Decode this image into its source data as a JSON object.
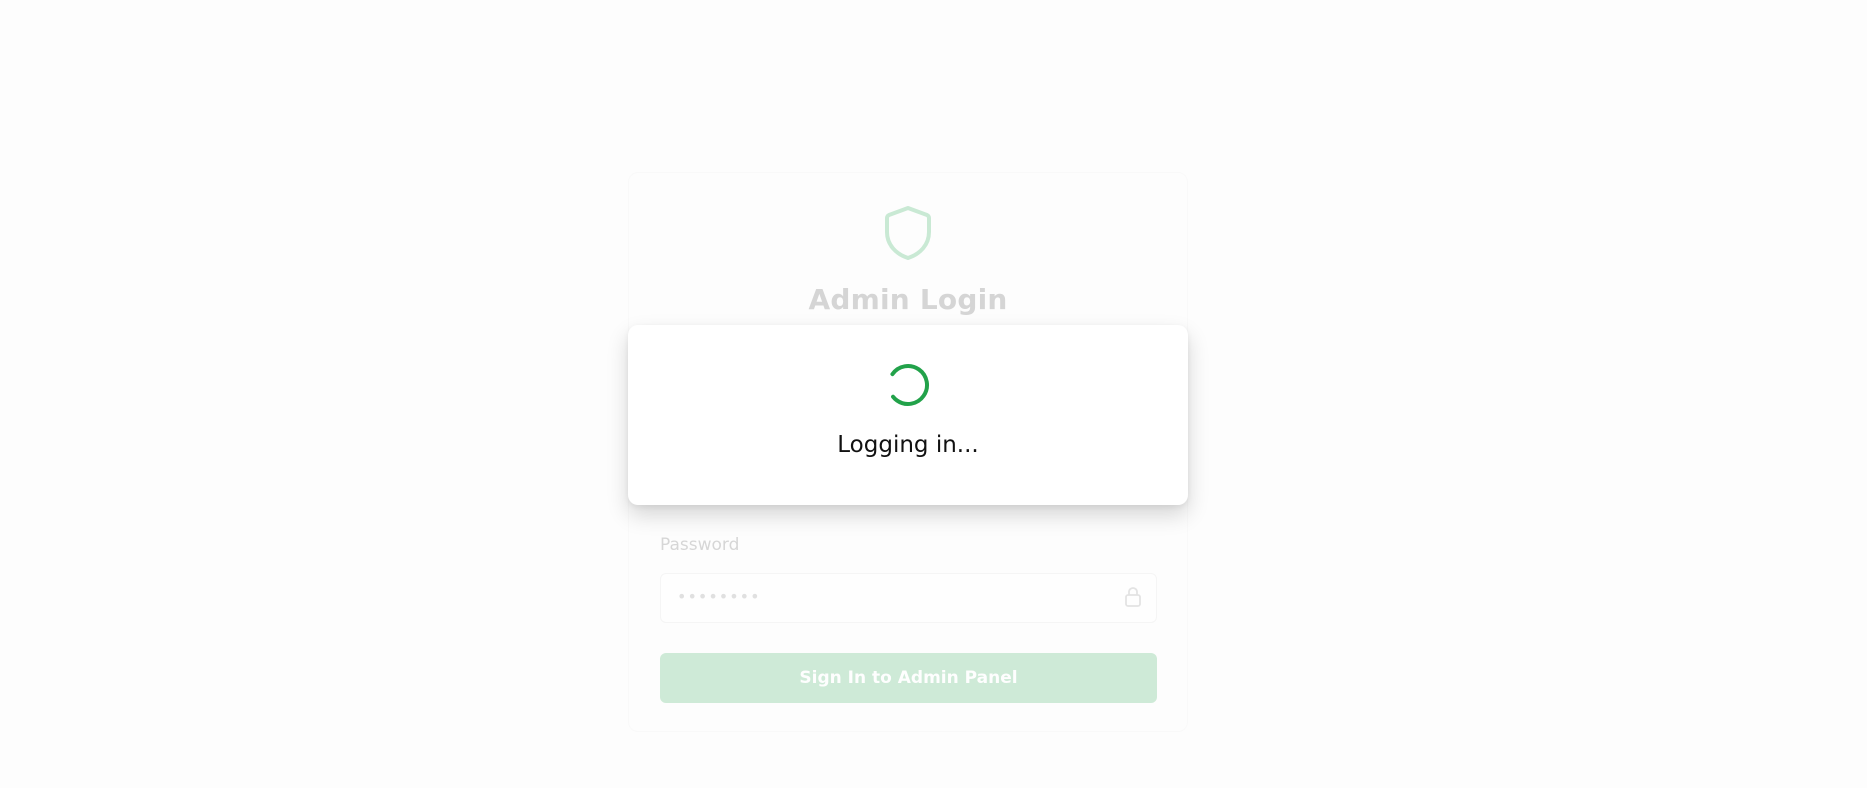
{
  "login_card": {
    "title": "Admin Login",
    "shield_icon": "shield-icon",
    "password_label": "Password",
    "password_value": "••••••••",
    "lock_icon": "lock-icon",
    "submit_label": "Sign In to Admin Panel"
  },
  "loading_overlay": {
    "spinner_icon": "spinner-icon",
    "message": "Logging in..."
  },
  "colors": {
    "accent": "#22a24a",
    "accent_faded": "#a8dcb9"
  }
}
